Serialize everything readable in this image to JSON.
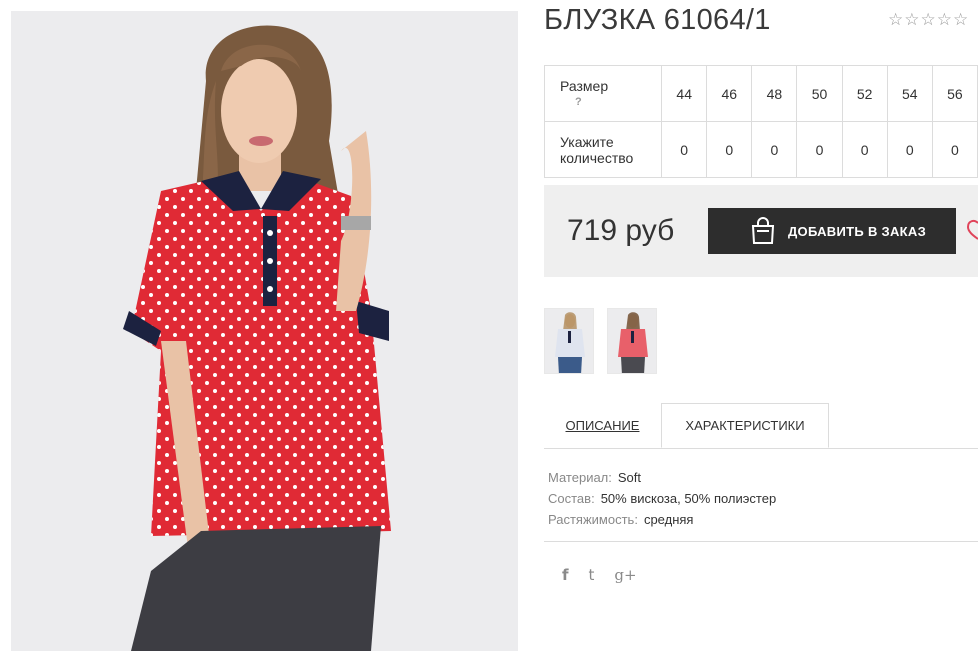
{
  "product": {
    "title": "БЛУЗКА 61064/1",
    "rating_stars": 5,
    "rating_value": 0
  },
  "sizes": {
    "size_label": "Размер",
    "help_mark": "?",
    "qty_label": "Укажите количество",
    "list": [
      "44",
      "46",
      "48",
      "50",
      "52",
      "54",
      "56"
    ],
    "quantities": [
      "0",
      "0",
      "0",
      "0",
      "0",
      "0",
      "0"
    ]
  },
  "buy": {
    "price": "719 руб",
    "add_label": "ДОБАВИТЬ В ЗАКАЗ"
  },
  "tabs": {
    "description": "ОПИСАНИЕ",
    "characteristics": "ХАРАКТЕРИСТИКИ"
  },
  "specs": [
    {
      "key": "Материал:",
      "value": "Soft"
    },
    {
      "key": "Состав:",
      "value": "50% вискоза, 50% полиэстер"
    },
    {
      "key": "Растяжимость:",
      "value": "средняя"
    }
  ],
  "social": {
    "facebook": "f",
    "twitter": "t",
    "google": "g+"
  },
  "colors": {
    "blouse_red": "#e02a35",
    "collar_navy": "#1c2240",
    "button_dark": "#2d2d2d",
    "panel_gray": "#efefef"
  }
}
